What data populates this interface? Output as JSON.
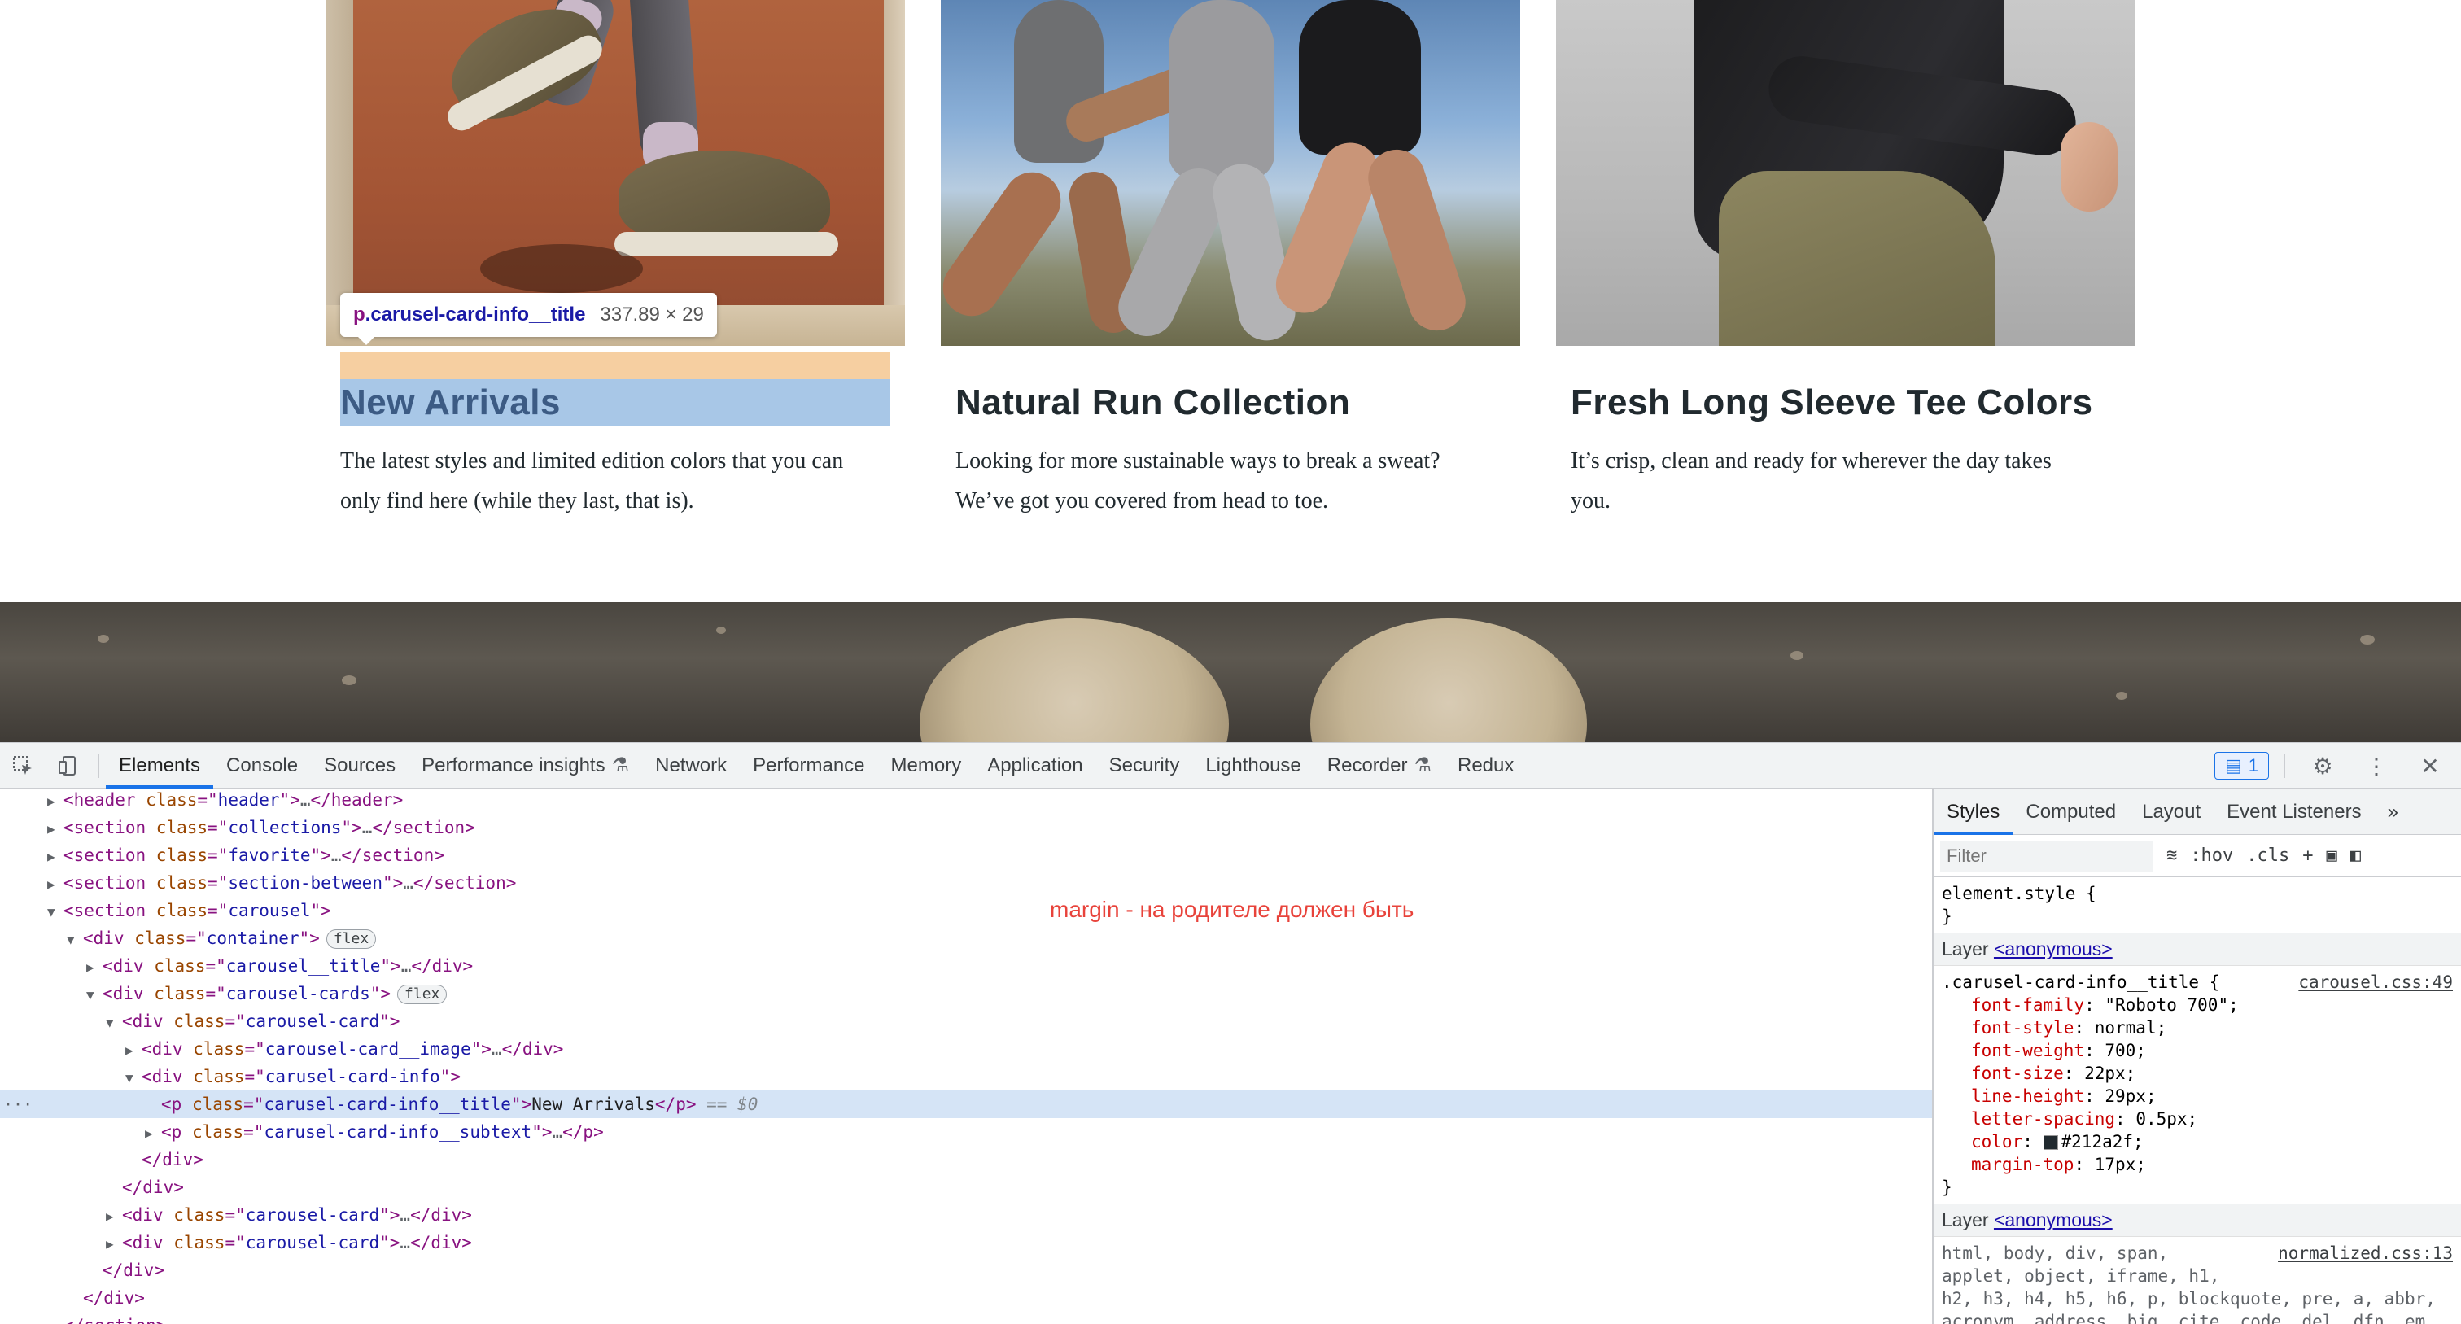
{
  "page": {
    "tooltip": {
      "tag": "p",
      "class": ".carusel-card-info__title",
      "size": "337.89 × 29"
    },
    "cards": [
      {
        "title": "New Arrivals",
        "subtitle_lines": [
          "The latest styles and limited edition colors that you can",
          "only find here (while they last, that is)."
        ]
      },
      {
        "title": "Natural Run Collection",
        "subtitle_lines": [
          "Looking for more sustainable ways to break a sweat?",
          "We’ve got you covered from head to toe."
        ]
      },
      {
        "title": "Fresh Long Sleeve Tee Colors",
        "subtitle_lines": [
          "It’s crisp, clean and ready for wherever the day takes",
          "you."
        ]
      }
    ]
  },
  "devtools": {
    "tabs": [
      "Elements",
      "Console",
      "Sources",
      "Performance insights",
      "Network",
      "Performance",
      "Memory",
      "Application",
      "Security",
      "Lighthouse",
      "Recorder",
      "Redux"
    ],
    "active_tab": "Elements",
    "issues_count": "1",
    "annotation": "margin - на родителе должен быть",
    "dom_lines": [
      {
        "indent": 0,
        "tri": "▶",
        "text": [
          [
            "tag",
            "<header "
          ],
          [
            "attr",
            "class"
          ],
          [
            "tag",
            "=\""
          ],
          [
            "val",
            "header"
          ],
          [
            "tag",
            "\">"
          ],
          [
            "dots",
            "…"
          ],
          [
            "tag",
            "</header>"
          ]
        ]
      },
      {
        "indent": 0,
        "tri": "▶",
        "text": [
          [
            "tag",
            "<section "
          ],
          [
            "attr",
            "class"
          ],
          [
            "tag",
            "=\""
          ],
          [
            "val",
            "collections"
          ],
          [
            "tag",
            "\">"
          ],
          [
            "dots",
            "…"
          ],
          [
            "tag",
            "</section>"
          ]
        ]
      },
      {
        "indent": 0,
        "tri": "▶",
        "text": [
          [
            "tag",
            "<section "
          ],
          [
            "attr",
            "class"
          ],
          [
            "tag",
            "=\""
          ],
          [
            "val",
            "favorite"
          ],
          [
            "tag",
            "\">"
          ],
          [
            "dots",
            "…"
          ],
          [
            "tag",
            "</section>"
          ]
        ]
      },
      {
        "indent": 0,
        "tri": "▶",
        "text": [
          [
            "tag",
            "<section "
          ],
          [
            "attr",
            "class"
          ],
          [
            "tag",
            "=\""
          ],
          [
            "val",
            "section-between"
          ],
          [
            "tag",
            "\">"
          ],
          [
            "dots",
            "…"
          ],
          [
            "tag",
            "</section>"
          ]
        ]
      },
      {
        "indent": 0,
        "tri": "▼",
        "text": [
          [
            "tag",
            "<section "
          ],
          [
            "attr",
            "class"
          ],
          [
            "tag",
            "=\""
          ],
          [
            "val",
            "carousel"
          ],
          [
            "tag",
            "\">"
          ]
        ]
      },
      {
        "indent": 1,
        "tri": "▼",
        "text": [
          [
            "tag",
            "<div "
          ],
          [
            "attr",
            "class"
          ],
          [
            "tag",
            "=\""
          ],
          [
            "val",
            "container"
          ],
          [
            "tag",
            "\">"
          ]
        ],
        "badge": "flex"
      },
      {
        "indent": 2,
        "tri": "▶",
        "text": [
          [
            "tag",
            "<div "
          ],
          [
            "attr",
            "class"
          ],
          [
            "tag",
            "=\""
          ],
          [
            "val",
            "carousel__title"
          ],
          [
            "tag",
            "\">"
          ],
          [
            "dots",
            "…"
          ],
          [
            "tag",
            "</div>"
          ]
        ]
      },
      {
        "indent": 2,
        "tri": "▼",
        "text": [
          [
            "tag",
            "<div "
          ],
          [
            "attr",
            "class"
          ],
          [
            "tag",
            "=\""
          ],
          [
            "val",
            "carousel-cards"
          ],
          [
            "tag",
            "\">"
          ]
        ],
        "badge": "flex"
      },
      {
        "indent": 3,
        "tri": "▼",
        "text": [
          [
            "tag",
            "<div "
          ],
          [
            "attr",
            "class"
          ],
          [
            "tag",
            "=\""
          ],
          [
            "val",
            "carousel-card"
          ],
          [
            "tag",
            "\">"
          ]
        ]
      },
      {
        "indent": 4,
        "tri": "▶",
        "text": [
          [
            "tag",
            "<div "
          ],
          [
            "attr",
            "class"
          ],
          [
            "tag",
            "=\""
          ],
          [
            "val",
            "carousel-card__image"
          ],
          [
            "tag",
            "\">"
          ],
          [
            "dots",
            "…"
          ],
          [
            "tag",
            "</div>"
          ]
        ]
      },
      {
        "indent": 4,
        "tri": "▼",
        "text": [
          [
            "tag",
            "<div "
          ],
          [
            "attr",
            "class"
          ],
          [
            "tag",
            "=\""
          ],
          [
            "val",
            "carusel-card-info"
          ],
          [
            "tag",
            "\">"
          ]
        ]
      },
      {
        "indent": 5,
        "tri": "",
        "selected": true,
        "text": [
          [
            "tag",
            "<p "
          ],
          [
            "attr",
            "class"
          ],
          [
            "tag",
            "=\""
          ],
          [
            "val",
            "carusel-card-info__title"
          ],
          [
            "tag",
            "\">"
          ],
          [
            "plain",
            "New Arrivals"
          ],
          [
            "tag",
            "</p>"
          ],
          [
            "eq",
            " == $0"
          ]
        ]
      },
      {
        "indent": 5,
        "tri": "▶",
        "text": [
          [
            "tag",
            "<p "
          ],
          [
            "attr",
            "class"
          ],
          [
            "tag",
            "=\""
          ],
          [
            "val",
            "carusel-card-info__subtext"
          ],
          [
            "tag",
            "\">"
          ],
          [
            "dots",
            "…"
          ],
          [
            "tag",
            "</p>"
          ]
        ]
      },
      {
        "indent": 4,
        "tri": "",
        "text": [
          [
            "tag",
            "</div>"
          ]
        ]
      },
      {
        "indent": 3,
        "tri": "",
        "text": [
          [
            "tag",
            "</div>"
          ]
        ]
      },
      {
        "indent": 3,
        "tri": "▶",
        "text": [
          [
            "tag",
            "<div "
          ],
          [
            "attr",
            "class"
          ],
          [
            "tag",
            "=\""
          ],
          [
            "val",
            "carousel-card"
          ],
          [
            "tag",
            "\">"
          ],
          [
            "dots",
            "…"
          ],
          [
            "tag",
            "</div>"
          ]
        ]
      },
      {
        "indent": 3,
        "tri": "▶",
        "text": [
          [
            "tag",
            "<div "
          ],
          [
            "attr",
            "class"
          ],
          [
            "tag",
            "=\""
          ],
          [
            "val",
            "carousel-card"
          ],
          [
            "tag",
            "\">"
          ],
          [
            "dots",
            "…"
          ],
          [
            "tag",
            "</div>"
          ]
        ]
      },
      {
        "indent": 2,
        "tri": "",
        "text": [
          [
            "tag",
            "</div>"
          ]
        ]
      },
      {
        "indent": 1,
        "tri": "",
        "text": [
          [
            "tag",
            "</div>"
          ]
        ]
      },
      {
        "indent": 0,
        "tri": "",
        "text": [
          [
            "tag",
            "</section>"
          ]
        ]
      }
    ],
    "styles_panel": {
      "tabs": [
        "Styles",
        "Computed",
        "Layout",
        "Event Listeners",
        "»"
      ],
      "active_tab": "Styles",
      "filter_placeholder": "Filter",
      "toolbar": [
        ":hov",
        ".cls",
        "+"
      ],
      "element_style": "element.style {",
      "close_brace": "}",
      "layer_label": "Layer",
      "layer_link": "<anonymous>",
      "rule_selector": ".carusel-card-info__title {",
      "rule_source": "carousel.css:49",
      "declarations": [
        {
          "prop": "font-family",
          "value": "\"Roboto 700\";"
        },
        {
          "prop": "font-style",
          "value": "normal;"
        },
        {
          "prop": "font-weight",
          "value": "700;"
        },
        {
          "prop": "font-size",
          "value": "22px;"
        },
        {
          "prop": "line-height",
          "value": "29px;"
        },
        {
          "prop": "letter-spacing",
          "value": "0.5px;"
        },
        {
          "prop": "color",
          "value": "#212a2f;",
          "swatch": "#212a2f"
        },
        {
          "prop": "margin-top",
          "value": "17px;"
        }
      ],
      "second_source": "normalized.css:13",
      "second_selector_lines": [
        "html, body, div, span,",
        "applet, object, iframe, h1,",
        "h2, h3, h4, h5, h6, p, blockquote, pre, a, abbr,",
        "acronym, address, big, cite, code, del, dfn, em,"
      ]
    }
  }
}
